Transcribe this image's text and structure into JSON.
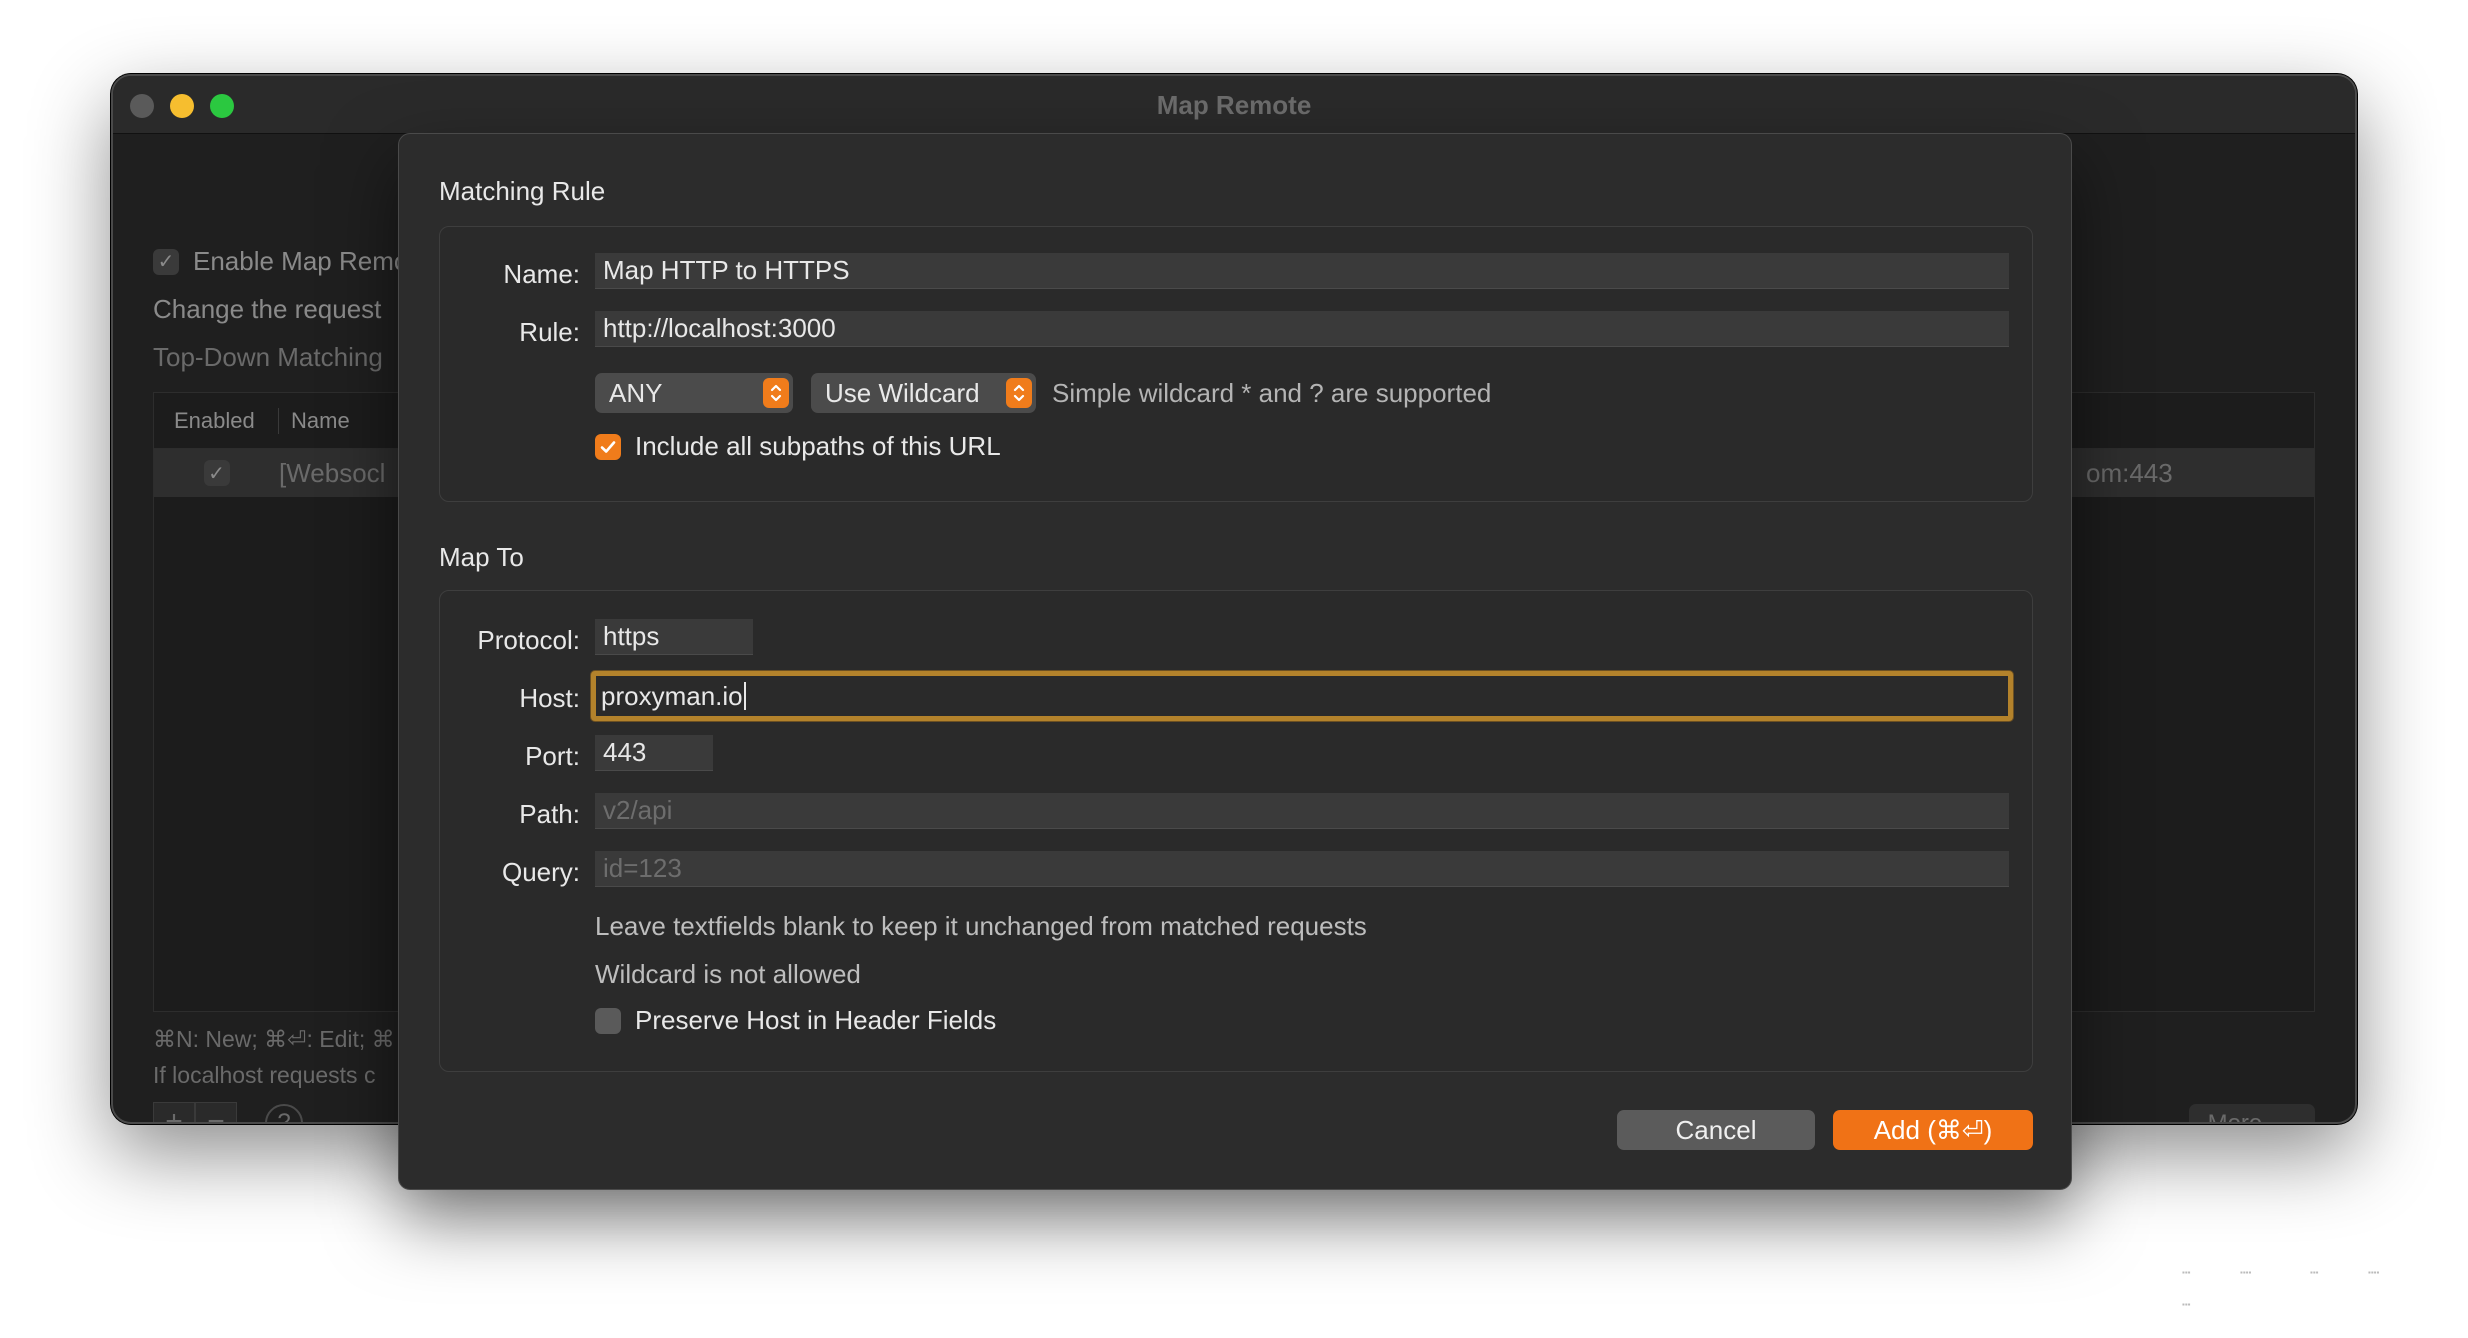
{
  "window": {
    "title": "Map Remote"
  },
  "background": {
    "enable_label": "Enable Map Remo",
    "description": "Change the request",
    "matching_mode": "Top-Down Matching",
    "table": {
      "columns": [
        "Enabled",
        "Name"
      ],
      "rows": [
        {
          "name": "[Websocl",
          "right_text": "om:443"
        }
      ]
    },
    "shortcuts_hint": "⌘N: New; ⌘⏎: Edit; ⌘",
    "localhost_hint": "If localhost requests c",
    "add_symbol": "+",
    "remove_symbol": "−",
    "help_symbol": "?",
    "more_label": "More"
  },
  "dialog": {
    "matching_rule": {
      "section_title": "Matching Rule",
      "name_label": "Name:",
      "name_value": "Map HTTP to HTTPS",
      "rule_label": "Rule:",
      "rule_value": "http://localhost:3000",
      "method_selected": "ANY",
      "match_type_selected": "Use Wildcard",
      "wildcard_hint": "Simple wildcard * and ? are supported",
      "include_subpaths_label": "Include all subpaths of this URL",
      "include_subpaths_checked": true
    },
    "map_to": {
      "section_title": "Map To",
      "protocol_label": "Protocol:",
      "protocol_value": "https",
      "host_label": "Host:",
      "host_value": "proxyman.io",
      "port_label": "Port:",
      "port_value": "443",
      "path_label": "Path:",
      "path_placeholder": "v2/api",
      "query_label": "Query:",
      "query_placeholder": "id=123",
      "note_blank": "Leave textfields blank to keep it unchanged from matched requests",
      "note_wildcard": "Wildcard is not allowed",
      "preserve_host_label": "Preserve Host in Header Fields",
      "preserve_host_checked": false
    },
    "buttons": {
      "cancel_label": "Cancel",
      "add_label": "Add (⌘⏎)"
    }
  },
  "colors": {
    "accent": "#f07216",
    "focus_ring": "#b3822b",
    "sheet_bg": "#2c2c2c",
    "field_bg": "#3a3a3a"
  }
}
